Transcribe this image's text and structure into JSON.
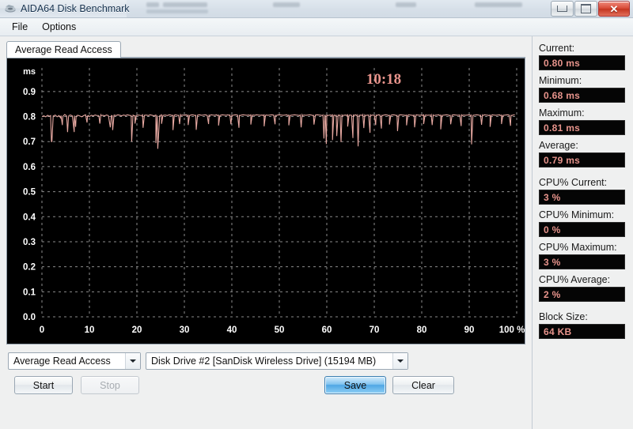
{
  "window": {
    "title": "AIDA64 Disk Benchmark",
    "icon": "disk-drive-icon",
    "buttons": {
      "minimize": "minimize-icon",
      "maximize": "maximize-icon",
      "close": "close-icon"
    }
  },
  "menu": {
    "items": [
      "File",
      "Options"
    ]
  },
  "tab": {
    "label": "Average Read Access"
  },
  "chart_data": {
    "type": "line",
    "title": "",
    "timer": "10:18",
    "xlabel": "%",
    "ylabel": "ms",
    "unit_label": "ms",
    "xlim": [
      0,
      100
    ],
    "ylim": [
      0.0,
      0.95
    ],
    "x_ticks": [
      0,
      10,
      20,
      30,
      40,
      50,
      60,
      70,
      80,
      90,
      100
    ],
    "x_tick_labels": [
      "0",
      "10",
      "20",
      "30",
      "40",
      "50",
      "60",
      "70",
      "80",
      "90",
      "100 %"
    ],
    "y_ticks": [
      0.0,
      0.1,
      0.2,
      0.3,
      0.4,
      0.5,
      0.6,
      0.7,
      0.8,
      0.9
    ],
    "y_tick_labels": [
      "0.0",
      "0.1",
      "0.2",
      "0.3",
      "0.4",
      "0.5",
      "0.6",
      "0.7",
      "0.8",
      "0.9"
    ],
    "grid": true,
    "grid_color": "#8c8c8c",
    "line_color": "#e6a8a1",
    "background": "#000000",
    "legend": "none",
    "series": [
      {
        "name": "Average Read Access",
        "x": [
          0,
          0.4,
          0.8,
          1.2,
          1.6,
          2.0,
          2.4,
          2.8,
          3.2,
          3.6,
          4.0,
          4.4,
          4.8,
          5.2,
          5.6,
          6.0,
          6.4,
          6.8,
          7.2,
          7.6,
          8.0,
          8.4,
          8.8,
          9.2,
          9.6,
          10.0,
          10.4,
          10.8,
          11.2,
          11.6,
          12.0,
          12.4,
          12.8,
          13.2,
          13.6,
          14.0,
          14.4,
          14.8,
          15.2,
          15.6,
          16.0,
          16.4,
          16.8,
          17.2,
          17.6,
          18.0,
          18.4,
          18.8,
          19.2,
          19.6,
          20.0,
          20.4,
          20.8,
          21.2,
          21.6,
          22.0,
          22.4,
          22.8,
          23.2,
          23.6,
          24.0,
          24.4,
          24.8,
          25.2,
          25.6,
          26.0,
          26.4,
          26.8,
          27.2,
          27.6,
          28.0,
          28.4,
          28.8,
          29.2,
          29.6,
          30.0,
          30.4,
          30.8,
          31.2,
          31.6,
          32.0,
          32.4,
          32.8,
          33.2,
          33.6,
          34.0,
          34.4,
          34.8,
          35.2,
          35.6,
          36.0,
          36.4,
          36.8,
          37.2,
          37.6,
          38.0,
          38.4,
          38.8,
          39.2,
          39.6,
          40.0,
          40.4,
          40.8,
          41.2,
          41.6,
          42.0,
          42.4,
          42.8,
          43.2,
          43.6,
          44.0,
          44.4,
          44.8,
          45.2,
          45.6,
          46.0,
          46.4,
          46.8,
          47.2,
          47.6,
          48.0,
          48.4,
          48.8,
          49.2,
          49.6,
          50.0,
          50.4,
          50.8,
          51.2,
          51.6,
          52.0,
          52.4,
          52.8,
          53.2,
          53.6,
          54.0,
          54.4,
          54.8,
          55.2,
          55.6,
          56.0,
          56.4,
          56.8,
          57.2,
          57.6,
          58.0,
          58.4,
          58.8,
          59.2,
          59.6,
          60.0,
          60.4,
          60.8,
          61.2,
          61.6,
          62.0,
          62.4,
          62.8,
          63.2,
          63.6,
          64.0,
          64.4,
          64.8,
          65.2,
          65.6,
          66.0,
          66.4,
          66.8,
          67.2,
          67.6,
          68.0,
          68.4,
          68.8,
          69.2,
          69.6,
          70.0,
          70.4,
          70.8,
          71.2,
          71.6,
          72.0,
          72.4,
          72.8,
          73.2,
          73.6,
          74.0,
          74.4,
          74.8,
          75.2,
          75.6,
          76.0,
          76.4,
          76.8,
          77.2,
          77.6,
          78.0,
          78.4,
          78.8,
          79.2,
          79.6,
          80.0,
          80.4,
          80.8,
          81.2,
          81.6,
          82.0,
          82.4,
          82.8,
          83.2,
          83.6,
          84.0,
          84.4,
          84.8,
          85.2,
          85.6,
          86.0,
          86.4,
          86.8,
          87.2,
          87.6,
          88.0,
          88.4,
          88.8,
          89.2,
          89.6,
          90.0,
          90.4,
          90.8,
          91.2,
          91.6,
          92.0,
          92.4,
          92.8,
          93.2,
          93.6,
          94.0,
          94.4,
          94.8,
          95.2,
          95.6,
          96.0,
          96.4,
          96.8,
          97.2,
          97.6,
          98.0,
          98.4,
          98.8,
          99.2,
          99.6,
          100.0
        ],
        "y": [
          0.8,
          0.803,
          0.799,
          0.805,
          0.801,
          0.7,
          0.802,
          0.806,
          0.799,
          0.804,
          0.793,
          0.801,
          0.808,
          0.802,
          0.799,
          0.806,
          0.803,
          0.738,
          0.8,
          0.805,
          0.802,
          0.799,
          0.804,
          0.807,
          0.802,
          0.8,
          0.805,
          0.803,
          0.806,
          0.804,
          0.802,
          0.807,
          0.805,
          0.803,
          0.806,
          0.804,
          0.757,
          0.803,
          0.806,
          0.804,
          0.807,
          0.805,
          0.803,
          0.806,
          0.804,
          0.807,
          0.805,
          0.804,
          0.806,
          0.803,
          0.805,
          0.806,
          0.804,
          0.807,
          0.805,
          0.806,
          0.804,
          0.807,
          0.805,
          0.803,
          0.806,
          0.671,
          0.804,
          0.807,
          0.805,
          0.806,
          0.804,
          0.807,
          0.806,
          0.805,
          0.807,
          0.806,
          0.805,
          0.807,
          0.806,
          0.805,
          0.807,
          0.806,
          0.805,
          0.807,
          0.806,
          0.805,
          0.806,
          0.807,
          0.805,
          0.806,
          0.807,
          0.805,
          0.806,
          0.807,
          0.806,
          0.805,
          0.807,
          0.806,
          0.805,
          0.807,
          0.806,
          0.805,
          0.807,
          0.806,
          0.805,
          0.806,
          0.807,
          0.806,
          0.805,
          0.806,
          0.807,
          0.806,
          0.805,
          0.806,
          0.807,
          0.806,
          0.805,
          0.807,
          0.806,
          0.805,
          0.806,
          0.807,
          0.806,
          0.805,
          0.806,
          0.807,
          0.806,
          0.805,
          0.806,
          0.807,
          0.806,
          0.805,
          0.806,
          0.807,
          0.806,
          0.805,
          0.806,
          0.807,
          0.806,
          0.805,
          0.806,
          0.807,
          0.806,
          0.805,
          0.806,
          0.807,
          0.806,
          0.805,
          0.806,
          0.807,
          0.806,
          0.805,
          0.806,
          0.807,
          0.806,
          0.805,
          0.806,
          0.807,
          0.806,
          0.805,
          0.806,
          0.807,
          0.806,
          0.805,
          0.806,
          0.807,
          0.806,
          0.805,
          0.806,
          0.807,
          0.806,
          0.805,
          0.806,
          0.807,
          0.806,
          0.805,
          0.806,
          0.807,
          0.806,
          0.805,
          0.806,
          0.807,
          0.806,
          0.805,
          0.806,
          0.807,
          0.806,
          0.805,
          0.806,
          0.807,
          0.806,
          0.805,
          0.806,
          0.807,
          0.806,
          0.805,
          0.806,
          0.807,
          0.806,
          0.805,
          0.806,
          0.807,
          0.806,
          0.805,
          0.806,
          0.807,
          0.806,
          0.805,
          0.806,
          0.807,
          0.806,
          0.805,
          0.806,
          0.807,
          0.806,
          0.805,
          0.806,
          0.807,
          0.806,
          0.805,
          0.806,
          0.807,
          0.806,
          0.805,
          0.806,
          0.807,
          0.806,
          0.805,
          0.806,
          0.807,
          0.806,
          0.805,
          0.806,
          0.807,
          0.806,
          0.805,
          0.806,
          0.807,
          0.806,
          0.805,
          0.806,
          0.807,
          0.806,
          0.805,
          0.806,
          0.807,
          0.806,
          0.805,
          0.806,
          0.807,
          0.806,
          0.805,
          0.806,
          0.807
        ]
      }
    ],
    "spikes": [
      {
        "x": 2.1,
        "y": 0.7
      },
      {
        "x": 4.3,
        "y": 0.766
      },
      {
        "x": 5.4,
        "y": 0.738
      },
      {
        "x": 7.1,
        "y": 0.759
      },
      {
        "x": 9.5,
        "y": 0.776
      },
      {
        "x": 12.2,
        "y": 0.772
      },
      {
        "x": 14.9,
        "y": 0.746
      },
      {
        "x": 18.9,
        "y": 0.7
      },
      {
        "x": 19.6,
        "y": 0.772
      },
      {
        "x": 21.3,
        "y": 0.755
      },
      {
        "x": 24.0,
        "y": 0.694
      },
      {
        "x": 25.2,
        "y": 0.771
      },
      {
        "x": 27.6,
        "y": 0.746
      },
      {
        "x": 29.0,
        "y": 0.77
      },
      {
        "x": 30.8,
        "y": 0.766
      },
      {
        "x": 32.5,
        "y": 0.747
      },
      {
        "x": 35.1,
        "y": 0.77
      },
      {
        "x": 37.2,
        "y": 0.764
      },
      {
        "x": 39.8,
        "y": 0.769
      },
      {
        "x": 41.5,
        "y": 0.755
      },
      {
        "x": 44.0,
        "y": 0.768
      },
      {
        "x": 46.8,
        "y": 0.761
      },
      {
        "x": 49.1,
        "y": 0.769
      },
      {
        "x": 52.0,
        "y": 0.765
      },
      {
        "x": 54.6,
        "y": 0.757
      },
      {
        "x": 57.3,
        "y": 0.768
      },
      {
        "x": 59.4,
        "y": 0.712
      },
      {
        "x": 59.9,
        "y": 0.69
      },
      {
        "x": 61.2,
        "y": 0.706
      },
      {
        "x": 62.1,
        "y": 0.722
      },
      {
        "x": 63.0,
        "y": 0.698
      },
      {
        "x": 64.4,
        "y": 0.76
      },
      {
        "x": 65.5,
        "y": 0.714
      },
      {
        "x": 66.6,
        "y": 0.681
      },
      {
        "x": 67.8,
        "y": 0.754
      },
      {
        "x": 69.1,
        "y": 0.735
      },
      {
        "x": 70.3,
        "y": 0.766
      },
      {
        "x": 71.5,
        "y": 0.752
      },
      {
        "x": 73.2,
        "y": 0.768
      },
      {
        "x": 74.9,
        "y": 0.742
      },
      {
        "x": 76.8,
        "y": 0.765
      },
      {
        "x": 78.5,
        "y": 0.757
      },
      {
        "x": 80.4,
        "y": 0.77
      },
      {
        "x": 82.2,
        "y": 0.766
      },
      {
        "x": 84.0,
        "y": 0.749
      },
      {
        "x": 86.1,
        "y": 0.769
      },
      {
        "x": 88.3,
        "y": 0.762
      },
      {
        "x": 90.5,
        "y": 0.689
      },
      {
        "x": 92.6,
        "y": 0.767
      },
      {
        "x": 94.4,
        "y": 0.759
      },
      {
        "x": 96.8,
        "y": 0.77
      },
      {
        "x": 98.7,
        "y": 0.763
      }
    ]
  },
  "controls": {
    "mode_select": {
      "value": "Average Read Access"
    },
    "drive_select": {
      "value": "Disk Drive #2  [SanDisk Wireless Drive]  (15194 MB)"
    },
    "start": "Start",
    "stop": "Stop",
    "save": "Save",
    "clear": "Clear"
  },
  "stats": [
    {
      "label": "Current:",
      "value": "0.80 ms",
      "gap": false
    },
    {
      "label": "Minimum:",
      "value": "0.68 ms",
      "gap": false
    },
    {
      "label": "Maximum:",
      "value": "0.81 ms",
      "gap": false
    },
    {
      "label": "Average:",
      "value": "0.79 ms",
      "gap": false
    },
    {
      "label": "CPU% Current:",
      "value": "3 %",
      "gap": true
    },
    {
      "label": "CPU% Minimum:",
      "value": "0 %",
      "gap": false
    },
    {
      "label": "CPU% Maximum:",
      "value": "3 %",
      "gap": false
    },
    {
      "label": "CPU% Average:",
      "value": "2 %",
      "gap": false
    },
    {
      "label": "Block Size:",
      "value": "64 KB",
      "gap": true
    }
  ]
}
